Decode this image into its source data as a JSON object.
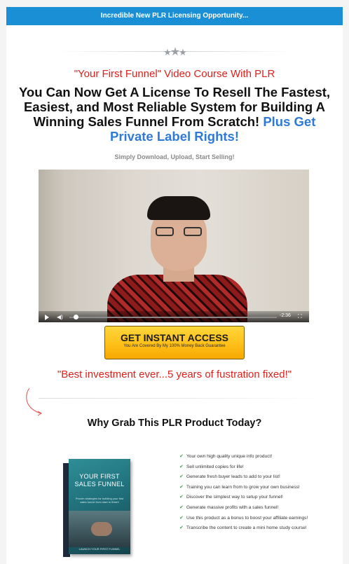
{
  "topbar": {
    "text": "Incredible New PLR Licensing Opportunity..."
  },
  "header": {
    "red_title": "\"Your First Funnel\" Video Course With PLR",
    "headline_main": "You Can Now Get A License To Resell The Fastest, Easiest, and Most Reliable System for Building A Winning Sales Funnel From Scratch!",
    "headline_blue": "Plus Get Private Label Rights!",
    "subline": "Simply Download, Upload, Start Selling!"
  },
  "video": {
    "time": "-2:36",
    "progress": 0.02
  },
  "cta": {
    "label": "GET INSTANT ACCESS",
    "sub": "You Are Covered By My 100% Money Back Guarantee"
  },
  "testimonial": {
    "quote": "\"Best investment ever...5 years of fustration fixed!\""
  },
  "why": {
    "title": "Why Grab This PLR Product Today?"
  },
  "product": {
    "title": "YOUR FIRST SALES FUNNEL",
    "desc": "Proven strategies for building your first sales funnel from start to finish!",
    "author": "LAUNCH YOUR FIRST FUNNEL"
  },
  "benefits": [
    "Your own high quality unique info product!",
    "Sell unlimited copies for life!",
    "Generate fresh buyer leads to add to your list!",
    "Training you can learn from to grow your own business!",
    "Discover the simplest way to setup your funnel!",
    "Generate massive profits with a sales funnel!",
    "Use this product as a bonus to boost your affiliate earnings!",
    "Transcribe the content to create a mini home study course!"
  ],
  "colors": {
    "topbar": "#1a8fd6",
    "red": "#e0201b",
    "blue": "#2f7ad9",
    "cta": "#ffc21c",
    "check": "#3aa64a"
  }
}
